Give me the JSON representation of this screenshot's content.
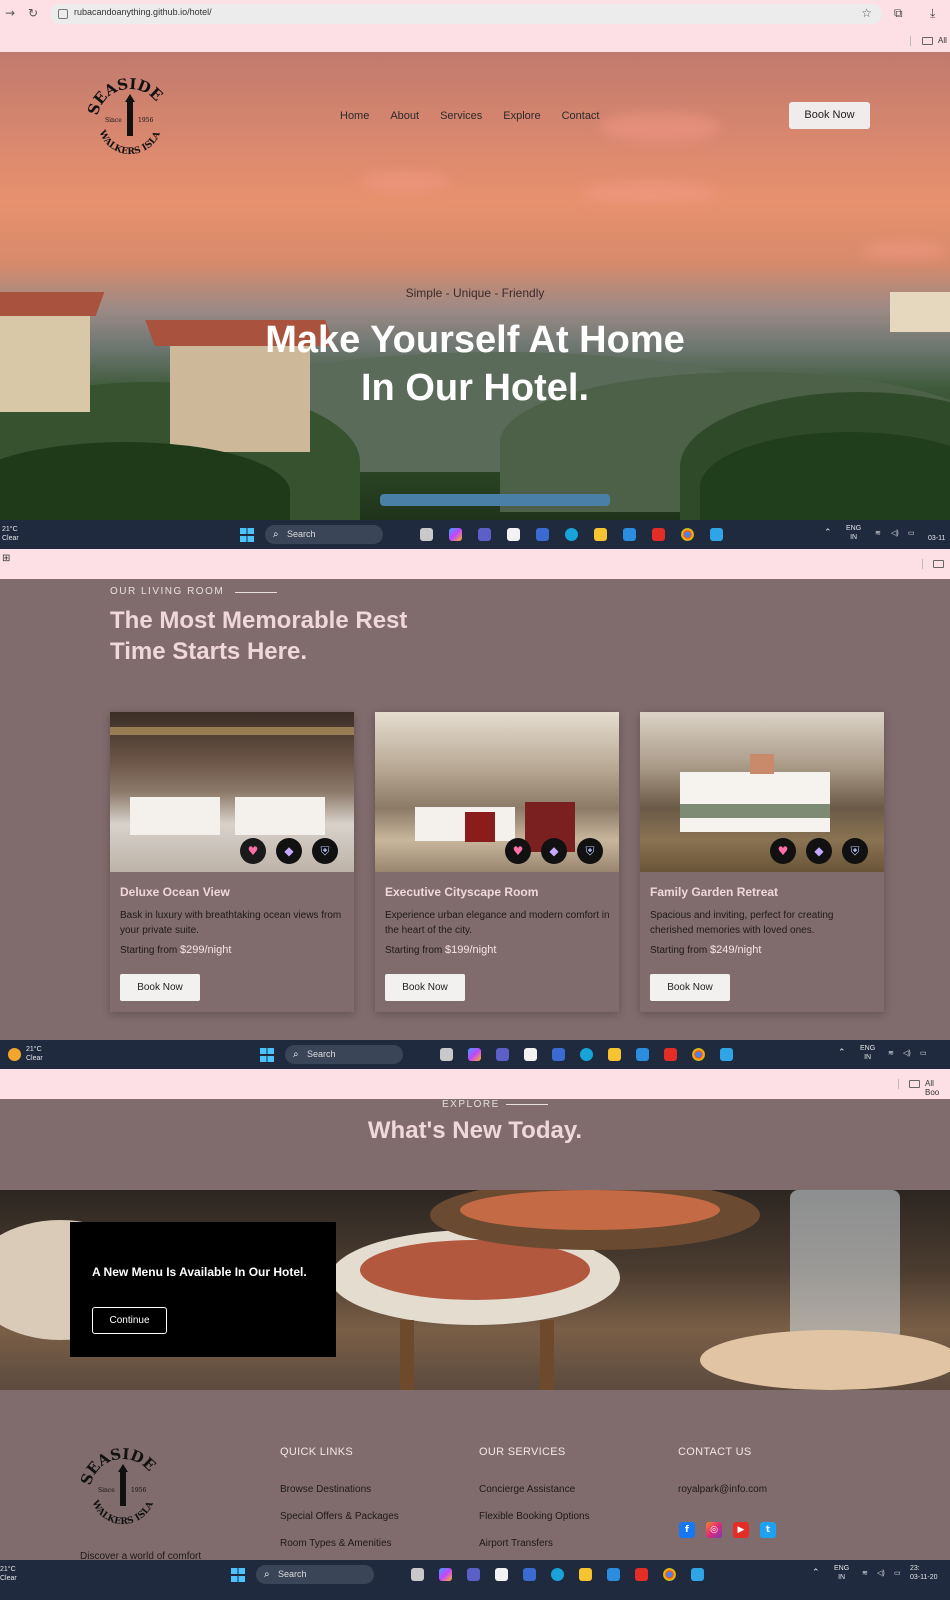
{
  "browser": {
    "url": "rubacandoanything.github.io/hotel/",
    "bookmarks_label": "All",
    "bookmarks_label_2": "All Boo"
  },
  "hero": {
    "logo": {
      "top": "SEASIDE",
      "since": "Since",
      "year": "1956",
      "bottom": "WALKERS ISLAND, NC"
    },
    "nav": [
      "Home",
      "About",
      "Services",
      "Explore",
      "Contact"
    ],
    "book_button": "Book Now",
    "tagline": "Simple - Unique - Friendly",
    "title_line1": "Make Yourself At Home",
    "title_line2": "In Our Hotel."
  },
  "taskbar": {
    "temp": "21°C",
    "condition": "Clear",
    "search": "Search",
    "lang": "ENG",
    "region": "IN",
    "time_partial": "03-11",
    "time_partial_3": "23:",
    "date_partial_3": "03-11-20"
  },
  "rooms": {
    "eyebrow": "OUR LIVING ROOM",
    "title_line1": "The Most Memorable Rest",
    "title_line2": "Time Starts Here.",
    "price_prefix": "Starting from",
    "items": [
      {
        "name": "Deluxe Ocean View",
        "desc": "Bask in luxury with breathtaking ocean views from your private suite.",
        "price": "$299/night",
        "button": "Book Now"
      },
      {
        "name": "Executive Cityscape Room",
        "desc": "Experience urban elegance and modern comfort in the heart of the city.",
        "price": "$199/night",
        "button": "Book Now"
      },
      {
        "name": "Family Garden Retreat",
        "desc": "Spacious and inviting, perfect for creating cherished memories with loved ones.",
        "price": "$249/night",
        "button": "Book Now"
      }
    ]
  },
  "explore": {
    "eyebrow": "EXPLORE",
    "title": "What's New Today.",
    "promo_text": "A New Menu Is Available In Our Hotel.",
    "promo_button": "Continue"
  },
  "footer": {
    "quick_links": {
      "title": "QUICK LINKS",
      "items": [
        "Browse Destinations",
        "Special Offers & Packages",
        "Room Types & Amenities"
      ]
    },
    "services": {
      "title": "OUR SERVICES",
      "items": [
        "Concierge Assistance",
        "Flexible Booking Options",
        "Airport Transfers"
      ]
    },
    "contact": {
      "title": "CONTACT US",
      "email": "royalpark@info.com"
    },
    "note": "Discover a world of comfort"
  },
  "colors": {
    "page_bg": "#806c6d",
    "heading": "#f1d8d8",
    "chrome": "#fde0e6",
    "taskbar": "#1f2a3f"
  },
  "icons": [
    "back-arrow-icon",
    "reload-icon",
    "site-settings-icon",
    "star-icon",
    "extensions-icon",
    "download-icon",
    "heart-icon",
    "paint-bucket-icon",
    "shield-icon",
    "facebook-icon",
    "instagram-icon",
    "youtube-icon",
    "twitter-icon"
  ]
}
